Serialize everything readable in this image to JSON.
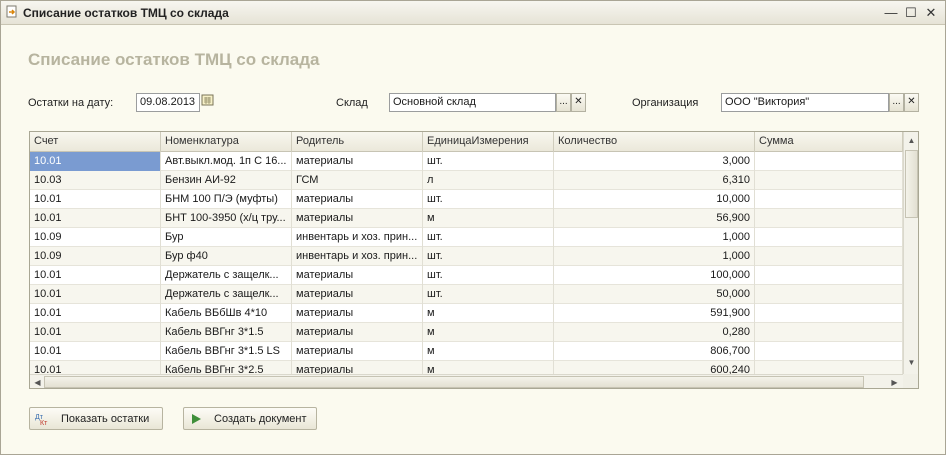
{
  "window": {
    "title": "Списание остатков ТМЦ со склада",
    "minimize": "—",
    "maximize": "☐",
    "close": "✕"
  },
  "form": {
    "title": "Списание остатков ТМЦ со склада",
    "date_label": "Остатки на дату:",
    "date_value": "09.08.2013",
    "warehouse_label": "Склад",
    "warehouse_value": "Основной склад",
    "org_label": "Организация",
    "org_value": "ООО \"Виктория\"",
    "select_glyph": "...",
    "clear_glyph": "✕"
  },
  "table": {
    "columns": [
      "Счет",
      "Номенклатура",
      "Родитель",
      "ЕдиницаИзмерения",
      "Количество",
      "Сумма"
    ],
    "rows": [
      [
        "10.01",
        "Авт.выкл.мод. 1п С 16...",
        "материалы",
        "шт.",
        "3,000",
        ""
      ],
      [
        "10.03",
        "Бензин АИ-92",
        "ГСМ",
        "л",
        "6,310",
        ""
      ],
      [
        "10.01",
        "БНМ 100 П/Э (муфты)",
        "материалы",
        "шт.",
        "10,000",
        ""
      ],
      [
        "10.01",
        "БНТ 100-3950 (х/ц тру...",
        "материалы",
        "м",
        "56,900",
        ""
      ],
      [
        "10.09",
        "Бур",
        "инвентарь и хоз. прин...",
        "шт.",
        "1,000",
        ""
      ],
      [
        "10.09",
        "Бур ф40",
        "инвентарь и хоз. прин...",
        "шт.",
        "1,000",
        ""
      ],
      [
        "10.01",
        "Держатель с защелк...",
        "материалы",
        "шт.",
        "100,000",
        ""
      ],
      [
        "10.01",
        "Держатель с защелк...",
        "материалы",
        "шт.",
        "50,000",
        ""
      ],
      [
        "10.01",
        "Кабель ВБбШв 4*10",
        "материалы",
        "м",
        "591,900",
        ""
      ],
      [
        "10.01",
        "Кабель ВВГнг 3*1.5",
        "материалы",
        "м",
        "0,280",
        ""
      ],
      [
        "10.01",
        "Кабель ВВГнг 3*1.5 LS",
        "материалы",
        "м",
        "806,700",
        ""
      ],
      [
        "10.01",
        "Кабель ВВГнг 3*2.5",
        "материалы",
        "м",
        "600,240",
        ""
      ]
    ]
  },
  "buttons": {
    "show_balances": "Показать остатки",
    "create_document": "Создать документ"
  },
  "colors": {
    "selection": "#7a9bd1",
    "form_title": "#b7b49f",
    "background": "#fbfaef"
  },
  "icons": {
    "window": "document-arrow-icon",
    "calendar": "calendar-icon",
    "show_balances": "dt-kt-icon",
    "create_document": "play-icon"
  }
}
